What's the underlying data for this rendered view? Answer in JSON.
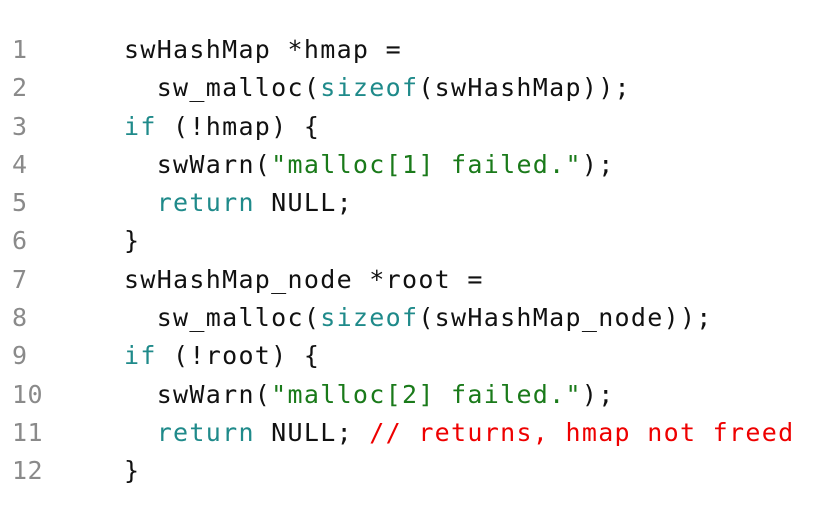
{
  "colors": {
    "background": "#ffffff",
    "line_number": "#8a8a8a",
    "plain": "#111111",
    "keyword": "#1f8a8a",
    "string": "#1a7a1a",
    "comment": "#ee0000"
  },
  "lines": [
    {
      "number": "1",
      "indent": 0,
      "tokens": [
        {
          "t": "plain",
          "v": "swHashMap *hmap ="
        }
      ]
    },
    {
      "number": "2",
      "indent": 1,
      "tokens": [
        {
          "t": "plain",
          "v": "sw_malloc("
        },
        {
          "t": "kw",
          "v": "sizeof"
        },
        {
          "t": "plain",
          "v": "(swHashMap));"
        }
      ]
    },
    {
      "number": "3",
      "indent": 0,
      "tokens": [
        {
          "t": "kw",
          "v": "if"
        },
        {
          "t": "plain",
          "v": " (!hmap) {"
        }
      ]
    },
    {
      "number": "4",
      "indent": 1,
      "tokens": [
        {
          "t": "plain",
          "v": "swWarn("
        },
        {
          "t": "str",
          "v": "\"malloc[1] failed.\""
        },
        {
          "t": "plain",
          "v": ");"
        }
      ]
    },
    {
      "number": "5",
      "indent": 1,
      "tokens": [
        {
          "t": "kw",
          "v": "return"
        },
        {
          "t": "plain",
          "v": " NULL;"
        }
      ]
    },
    {
      "number": "6",
      "indent": 0,
      "tokens": [
        {
          "t": "plain",
          "v": "}"
        }
      ]
    },
    {
      "number": "7",
      "indent": 0,
      "tokens": [
        {
          "t": "plain",
          "v": "swHashMap_node *root ="
        }
      ]
    },
    {
      "number": "8",
      "indent": 1,
      "tokens": [
        {
          "t": "plain",
          "v": "sw_malloc("
        },
        {
          "t": "kw",
          "v": "sizeof"
        },
        {
          "t": "plain",
          "v": "(swHashMap_node));"
        }
      ]
    },
    {
      "number": "9",
      "indent": 0,
      "tokens": [
        {
          "t": "kw",
          "v": "if"
        },
        {
          "t": "plain",
          "v": " (!root) {"
        }
      ]
    },
    {
      "number": "10",
      "indent": 1,
      "tokens": [
        {
          "t": "plain",
          "v": "swWarn("
        },
        {
          "t": "str",
          "v": "\"malloc[2] failed.\""
        },
        {
          "t": "plain",
          "v": ");"
        }
      ]
    },
    {
      "number": "11",
      "indent": 1,
      "tokens": [
        {
          "t": "kw",
          "v": "return"
        },
        {
          "t": "plain",
          "v": " NULL; "
        },
        {
          "t": "cmt",
          "v": "// returns, hmap not freed"
        }
      ]
    },
    {
      "number": "12",
      "indent": 0,
      "tokens": [
        {
          "t": "plain",
          "v": "}"
        }
      ]
    }
  ]
}
